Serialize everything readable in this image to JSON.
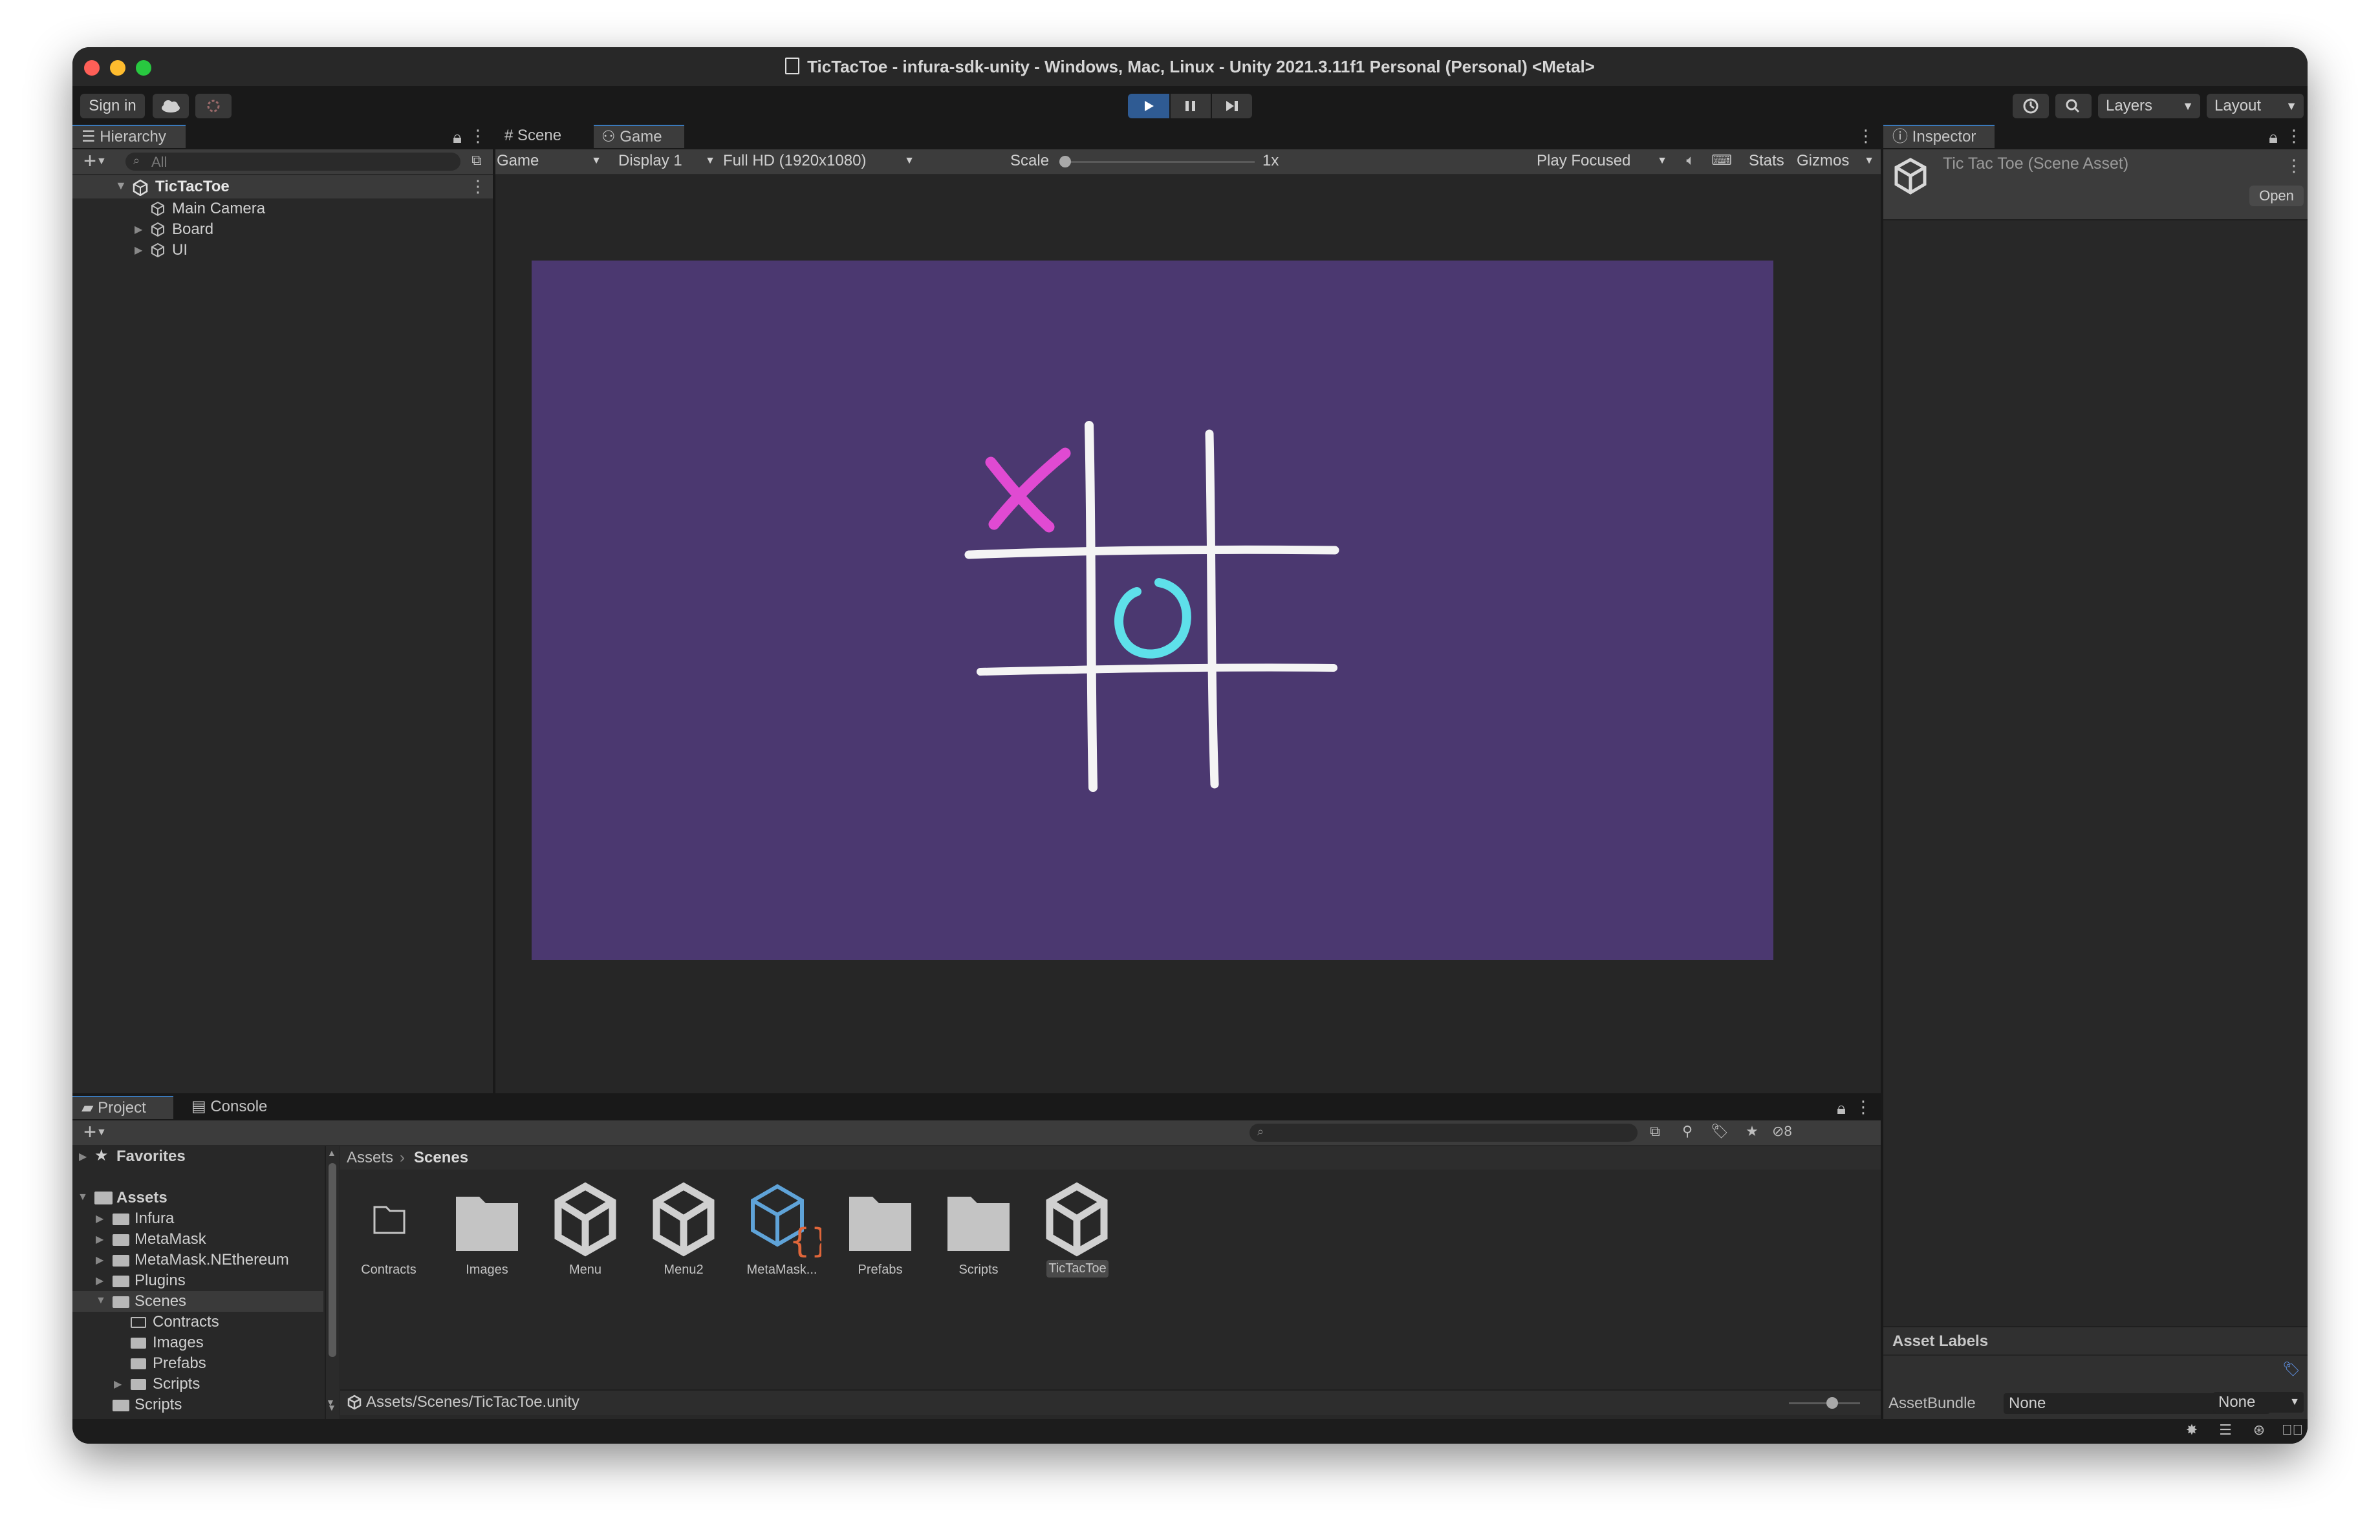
{
  "window": {
    "title": "TicTacToe - infura-sdk-unity - Windows, Mac, Linux - Unity 2021.3.11f1 Personal (Personal) <Metal>"
  },
  "toolbar": {
    "sign_in": "Sign in",
    "layers": "Layers",
    "layout": "Layout"
  },
  "hierarchy": {
    "tab": "Hierarchy",
    "search_placeholder": "All",
    "scene": "TicTacToe",
    "items": [
      "Main Camera",
      "Board",
      "UI"
    ]
  },
  "game": {
    "tabs": [
      "Scene",
      "Game"
    ],
    "mode": "Game",
    "display": "Display 1",
    "resolution": "Full HD (1920x1080)",
    "scale_label": "Scale",
    "scale_value": "1x",
    "play_focused": "Play Focused",
    "stats": "Stats",
    "gizmos": "Gizmos",
    "background_color": "#4b3870",
    "x_color": "#e04ad2",
    "o_color": "#5ee0ea"
  },
  "inspector": {
    "tab": "Inspector",
    "asset_title": "Tic Tac Toe (Scene Asset)",
    "open": "Open",
    "asset_labels": "Asset Labels",
    "asset_bundle_label": "AssetBundle",
    "asset_bundle_value": "None",
    "asset_bundle_variant": "None"
  },
  "project": {
    "tabs": [
      "Project",
      "Console"
    ],
    "hidden_count": "8",
    "favorites": "Favorites",
    "tree": {
      "assets": "Assets",
      "items": [
        "Infura",
        "MetaMask",
        "MetaMask.NEthereum",
        "Plugins",
        "Scenes"
      ],
      "scenes_children": [
        "Contracts",
        "Images",
        "Prefabs",
        "Scripts"
      ],
      "scripts": "Scripts"
    },
    "breadcrumb": [
      "Assets",
      "Scenes"
    ],
    "assets": [
      "Contracts",
      "Images",
      "Menu",
      "Menu2",
      "MetaMask...",
      "Prefabs",
      "Scripts",
      "TicTacToe"
    ],
    "path": "Assets/Scenes/TicTacToe.unity"
  }
}
